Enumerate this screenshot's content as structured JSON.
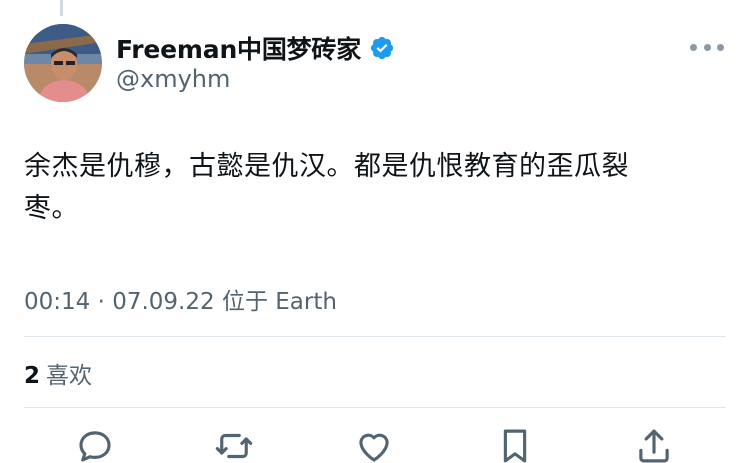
{
  "tweet": {
    "author": {
      "display_name": "Freeman中国梦砖家",
      "handle": "@xmyhm",
      "verified": true,
      "verified_color": "#1d9bf0"
    },
    "text_line1": "余杰是仇穆，古懿是仇汉。都是仇恨教育的歪瓜裂",
    "text_line2": "枣。",
    "timestamp": "00:14 · 07.09.22 位于 Earth"
  },
  "engagement": {
    "likes_count": "2",
    "likes_label": "喜欢"
  },
  "actions": [
    {
      "name": "reply",
      "icon": "reply-icon"
    },
    {
      "name": "retweet",
      "icon": "retweet-icon"
    },
    {
      "name": "like",
      "icon": "heart-icon"
    },
    {
      "name": "bookmark",
      "icon": "bookmark-icon"
    },
    {
      "name": "share",
      "icon": "share-icon"
    }
  ],
  "colors": {
    "primary_text": "#0f1419",
    "secondary_text": "#536471",
    "divider": "#e1e8ed"
  }
}
